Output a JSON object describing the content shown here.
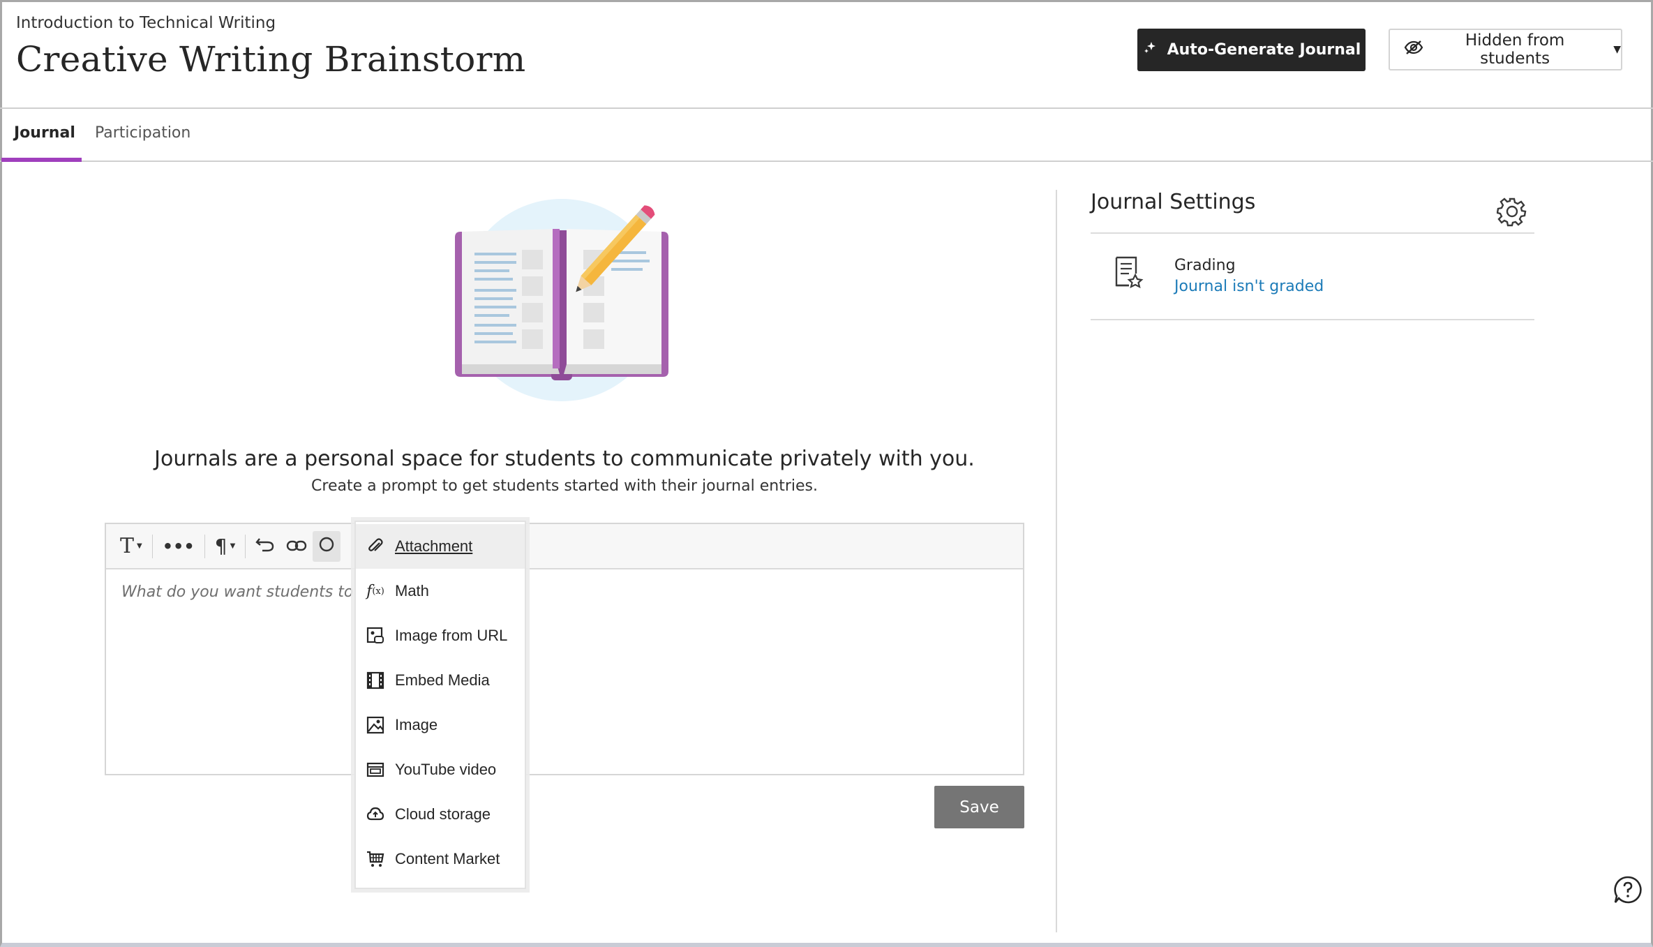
{
  "header": {
    "course_name": "Introduction to Technical Writing",
    "page_title": "Creative Writing Brainstorm",
    "autogen_label": "Auto-Generate Journal",
    "visibility_label": "Hidden from students"
  },
  "tabs": [
    {
      "label": "Journal",
      "active": true
    },
    {
      "label": "Participation",
      "active": false
    }
  ],
  "intro": {
    "title": "Journals are a personal space for students to communicate privately with you.",
    "subtitle": "Create a prompt to get students started with their journal entries."
  },
  "editor": {
    "placeholder": "What do you want students to focu",
    "toolbar_icons": [
      "text-format-icon",
      "more-icon",
      "paragraph-icon",
      "undo-icon",
      "link-icon",
      "insert-content-icon"
    ]
  },
  "save_label": "Save",
  "insert_menu": {
    "items": [
      {
        "label": "Attachment",
        "icon": "paperclip-icon"
      },
      {
        "label": "Math",
        "icon": "math-icon"
      },
      {
        "label": "Image from URL",
        "icon": "image-url-icon"
      },
      {
        "label": "Embed Media",
        "icon": "film-icon"
      },
      {
        "label": "Image",
        "icon": "image-icon"
      },
      {
        "label": "YouTube video",
        "icon": "video-icon"
      },
      {
        "label": "Cloud storage",
        "icon": "cloud-icon"
      },
      {
        "label": "Content Market",
        "icon": "cart-icon"
      }
    ]
  },
  "settings": {
    "title": "Journal Settings",
    "grading_label": "Grading",
    "grading_value": "Journal isn't graded"
  },
  "colors": {
    "accent": "#a03fbd",
    "link": "#1c7bb8",
    "primary_button": "#262626",
    "save_button": "#757575"
  }
}
